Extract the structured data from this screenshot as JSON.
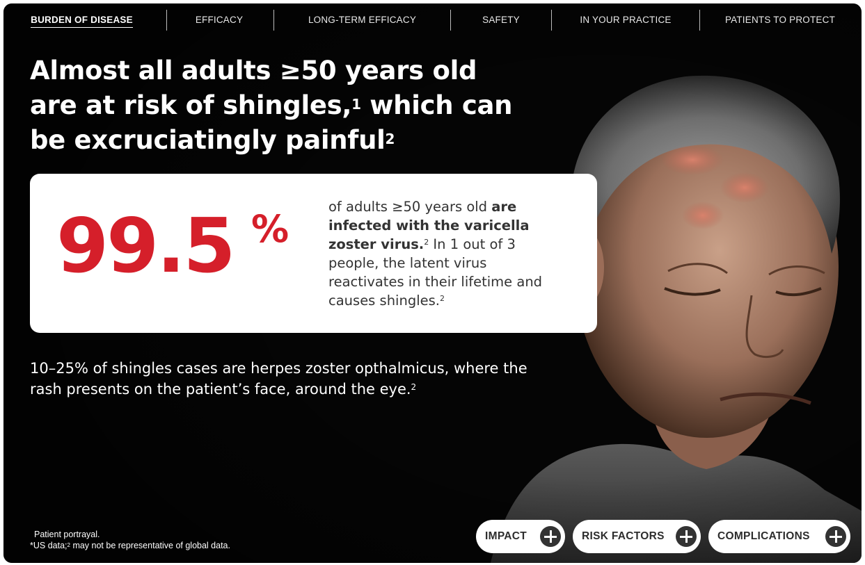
{
  "nav": {
    "items": [
      {
        "label": "BURDEN OF DISEASE"
      },
      {
        "label": "EFFICACY"
      },
      {
        "label": "LONG-TERM EFFICACY"
      },
      {
        "label": "SAFETY"
      },
      {
        "label": "IN YOUR PRACTICE"
      },
      {
        "label": "PATIENTS TO PROTECT"
      }
    ],
    "active_index": 0
  },
  "headline": {
    "part1": "Almost all adults ≥50 years old are at risk of shingles,",
    "ref1": "1",
    "part2": " which can be excruciatingly painful",
    "ref2": "2"
  },
  "stat_card": {
    "number": "99.5",
    "unit": "%",
    "text_intro": "of adults ≥50 years old ",
    "text_bold": "are infected with the varicella zoster virus.",
    "ref_a": "2",
    "text_rest": " In 1 out of 3 people, the latent virus reactivates in their lifetime and causes shingles.",
    "ref_b": "2"
  },
  "hzo": {
    "text": "10–25% of shingles cases are herpes zoster opthalmicus, where the rash presents on the patient’s face, around the eye.",
    "ref": "2"
  },
  "footnotes": {
    "line1": "Patient portrayal.",
    "line2_a": "*US data;",
    "line2_ref": "2",
    "line2_b": " may not be representative of global data."
  },
  "buttons": [
    {
      "label": "IMPACT",
      "icon": "plus-circle-icon"
    },
    {
      "label": "RISK FACTORS",
      "icon": "plus-circle-icon"
    },
    {
      "label": "COMPLICATIONS",
      "icon": "plus-circle-icon"
    }
  ],
  "colors": {
    "background": "#050505",
    "accent_red": "#d51f2a",
    "card": "#ffffff",
    "text_dark": "#333333"
  }
}
